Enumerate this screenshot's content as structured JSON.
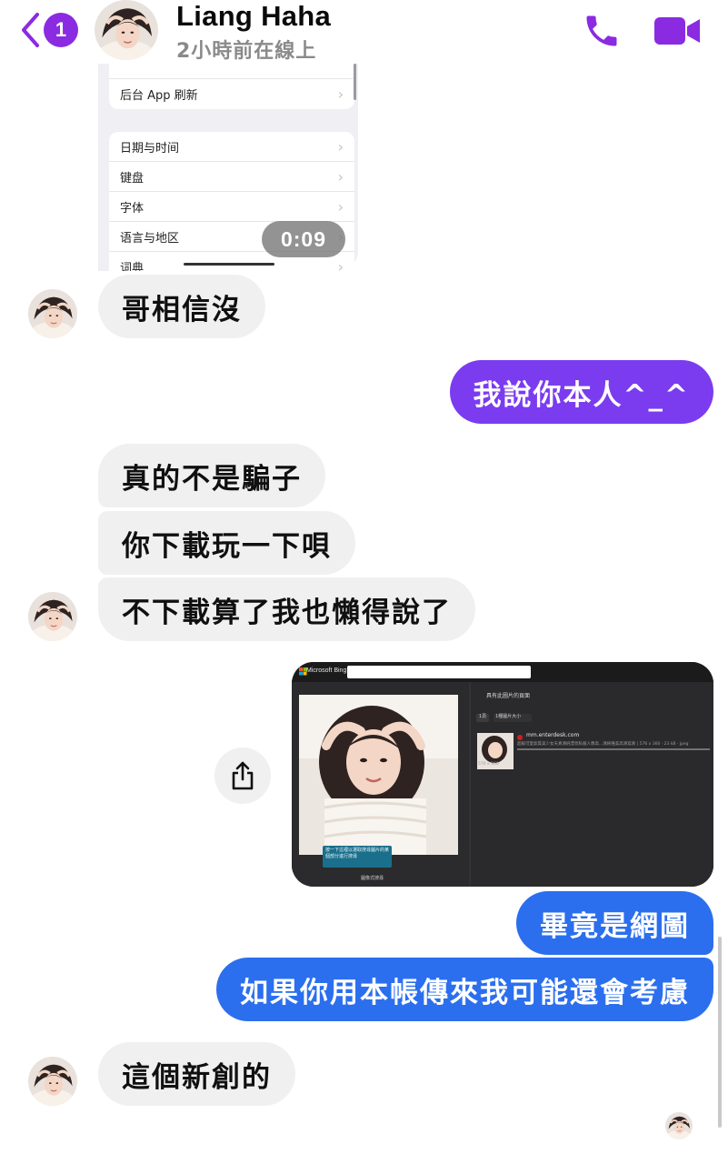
{
  "header": {
    "unread_count": "1",
    "name": "Liang Haha",
    "status": "2小時前在線上"
  },
  "video": {
    "partial_row": "后台 App 刷新",
    "rows": [
      "日期与时间",
      "键盘",
      "字体",
      "语言与地区",
      "词典"
    ],
    "duration": "0:09"
  },
  "messages": [
    {
      "side": "received",
      "text": "哥相信沒"
    },
    {
      "side": "sent",
      "text": "我說你本人^_^"
    },
    {
      "side": "received",
      "text": "真的不是騙子"
    },
    {
      "side": "received",
      "text": "你下載玩一下唄"
    },
    {
      "side": "received",
      "text": "不下載算了我也懶得說了"
    },
    {
      "side": "sent",
      "text": "畢竟是網圖"
    },
    {
      "side": "sent",
      "text": "如果你用本帳傳來我可能還會考慮"
    },
    {
      "side": "received",
      "text": "這個新創的"
    }
  ],
  "image_message": {
    "bing_brand": "Microsoft Bing",
    "panel_title": "具有此圖片的頁面",
    "tab1": "1頁",
    "tab2": "1種圖片大小",
    "result_site": "mm.enterdesk.com",
    "result_desc": "超級可愛氣質美少女天真清純漂亮私服人像高...清純唯美高清寫真 | 576 x 360 · 23 kB · jpeg",
    "result_size": "576 x 360",
    "tooltip": "按一下這裡以選取搜尋圖片的某個部分進行搜尋",
    "visual_search": "圖像式搜尋"
  },
  "colors": {
    "purple": "#7b3cf0",
    "blue": "#2b6fee",
    "received_bg": "#f0f0f0",
    "accent_icons": "#8a2be2"
  }
}
